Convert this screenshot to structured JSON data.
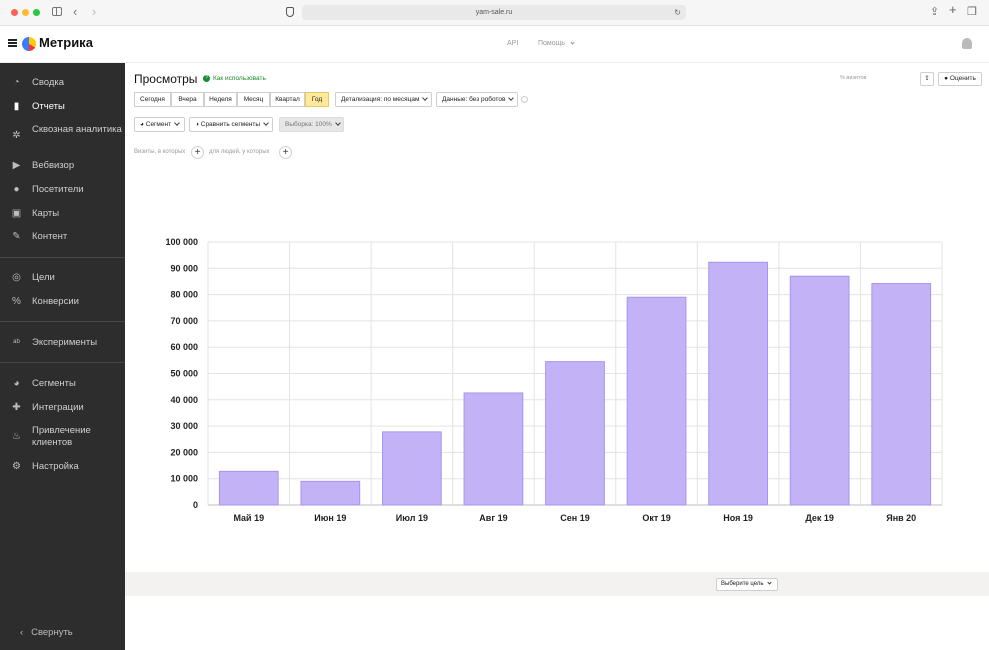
{
  "browser": {
    "url": "yam-sale.ru",
    "traffic_colors": [
      "#ff5f57",
      "#febc2e",
      "#28c840"
    ]
  },
  "header": {
    "logo": "Метрика",
    "api_label": "API",
    "help_label": "Помощь"
  },
  "sidebar": {
    "items": [
      {
        "label": "Сводка",
        "icon": "dashboard-icon"
      },
      {
        "label": "Отчеты",
        "icon": "reports-icon"
      },
      {
        "label": "Сквозная аналитика",
        "icon": "end-to-end-icon"
      },
      {
        "label": "Вебвизор",
        "icon": "play-icon"
      },
      {
        "label": "Посетители",
        "icon": "user-icon"
      },
      {
        "label": "Карты",
        "icon": "map-icon"
      },
      {
        "label": "Контент",
        "icon": "pencil-icon"
      },
      {
        "label": "Цели",
        "icon": "target-icon"
      },
      {
        "label": "Конверсии",
        "icon": "percent-icon"
      },
      {
        "label": "Эксперименты",
        "icon": "ab-icon"
      },
      {
        "label": "Сегменты",
        "icon": "pie-icon"
      },
      {
        "label": "Интеграции",
        "icon": "puzzle-icon"
      },
      {
        "label": "Привлечение клиентов",
        "icon": "flame-icon"
      },
      {
        "label": "Настройка",
        "icon": "gear-icon"
      }
    ],
    "active": "Отчеты",
    "collapse_label": "Свернуть"
  },
  "report": {
    "title": "Просмотры",
    "howto_label": "Как использовать",
    "visitors_label": "% визитов",
    "rate_label": "Оценить",
    "periods": [
      "Сегодня",
      "Вчера",
      "Неделя",
      "Месяц",
      "Квартал",
      "Год"
    ],
    "selected_period": "Год",
    "detail_label": "Детализация: по месяцам",
    "data_label": "Данные: без роботов",
    "segment_label": "Сегмент",
    "compare_label": "Сравнить сегменты",
    "sample_label": "Выборка: 100%",
    "visits_filter": "Визиты, в которых",
    "people_filter": "для людей, у которых"
  },
  "chart_data": {
    "type": "bar",
    "categories": [
      "Май 19",
      "Июн 19",
      "Июл 19",
      "Авг 19",
      "Сен 19",
      "Окт 19",
      "Ноя 19",
      "Дек 19",
      "Янв 20"
    ],
    "values": [
      12800,
      9000,
      27800,
      42600,
      54500,
      79000,
      92300,
      87000,
      84200
    ],
    "yticks": [
      "0",
      "10 000",
      "20 000",
      "30 000",
      "40 000",
      "50 000",
      "60 000",
      "70 000",
      "80 000",
      "90 000",
      "100 000"
    ],
    "ylim": [
      0,
      100000
    ],
    "grid": true,
    "bar_color": "#c4b2f7",
    "bar_stroke": "#a893ee"
  },
  "goal": {
    "select_label": "Выберите цель"
  }
}
